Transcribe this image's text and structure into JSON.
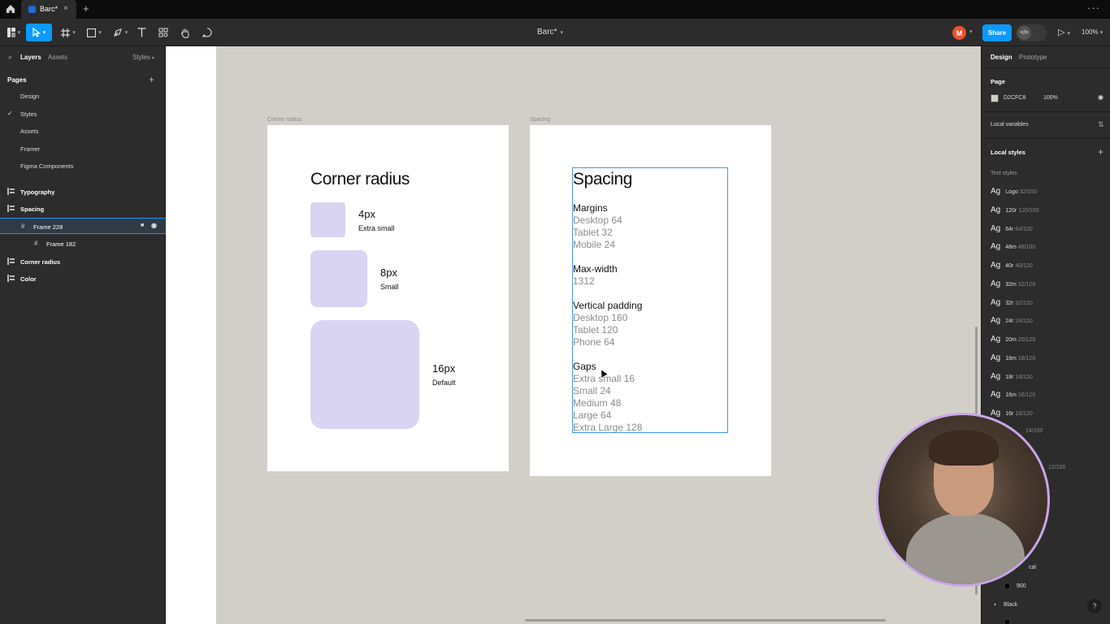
{
  "tabbar": {
    "tab_title": "Barc*",
    "close": "×",
    "new_tab": "+",
    "more": "···"
  },
  "toolbar": {
    "doc_title": "Barc*",
    "avatar_initial": "M",
    "share_label": "Share",
    "devmode_label": "</>",
    "present_icon": "▷",
    "zoom": "100%"
  },
  "left_panel": {
    "tabs": {
      "layers": "Layers",
      "assets": "Assets",
      "styles": "Styles"
    },
    "pages_heading": "Pages",
    "pages": [
      "Design",
      "Styles",
      "Assets",
      "Framer",
      "Figma Components"
    ],
    "current_page": "Styles",
    "layers": [
      "Typography",
      "Spacing",
      "Frame 228",
      "Frame 182",
      "Corner radius",
      "Color"
    ]
  },
  "canvas": {
    "background": "#D2CFC8",
    "corner_radius_frame": {
      "label": "Corner radius",
      "title": "Corner radius",
      "items": [
        {
          "value": "4px",
          "desc": "Extra small",
          "radius": 4
        },
        {
          "value": "8px",
          "desc": "Small",
          "radius": 8
        },
        {
          "value": "16px",
          "desc": "Default",
          "radius": 16
        }
      ],
      "box_color": "#D9D4F2"
    },
    "spacing_frame": {
      "label": "Spacing",
      "title": "Spacing",
      "groups": [
        {
          "heading": "Margins",
          "lines": [
            "Desktop 64",
            "Tablet 32",
            "Mobile 24"
          ]
        },
        {
          "heading": "Max-width",
          "lines": [
            "1312"
          ]
        },
        {
          "heading": "Vertical padding",
          "lines": [
            "Desktop 160",
            "Tablet 120",
            "Phone 64"
          ]
        },
        {
          "heading": "Gaps",
          "lines": [
            "Extra small 16",
            "Small 24",
            "Medium 48",
            "Large 64",
            "Extra Large 128"
          ]
        }
      ]
    }
  },
  "right_panel": {
    "tabs": {
      "design": "Design",
      "prototype": "Prototype"
    },
    "page_heading": "Page",
    "page_color": "D2CFC8",
    "page_opacity": "100%",
    "local_variables": "Local variables",
    "local_styles": "Local styles",
    "text_styles_heading": "Text styles",
    "text_styles": [
      {
        "name": "Logo",
        "size": "32/100"
      },
      {
        "name": "120r",
        "size": "120/100"
      },
      {
        "name": "64r",
        "size": "64/100"
      },
      {
        "name": "48m",
        "size": "48/100"
      },
      {
        "name": "40r",
        "size": "40/120"
      },
      {
        "name": "32m",
        "size": "32/120"
      },
      {
        "name": "32r",
        "size": "32/120"
      },
      {
        "name": "24r",
        "size": "24/120"
      },
      {
        "name": "20m",
        "size": "20/120"
      },
      {
        "name": "18m",
        "size": "18/120"
      },
      {
        "name": "18r",
        "size": "18/120"
      },
      {
        "name": "16m",
        "size": "16/120"
      },
      {
        "name": "16r",
        "size": "16/120"
      }
    ],
    "partial_1": "14/100",
    "partial_2": "12/100",
    "partial_3": "cal",
    "color_900": "900",
    "color_black": "Black",
    "help": "?"
  }
}
